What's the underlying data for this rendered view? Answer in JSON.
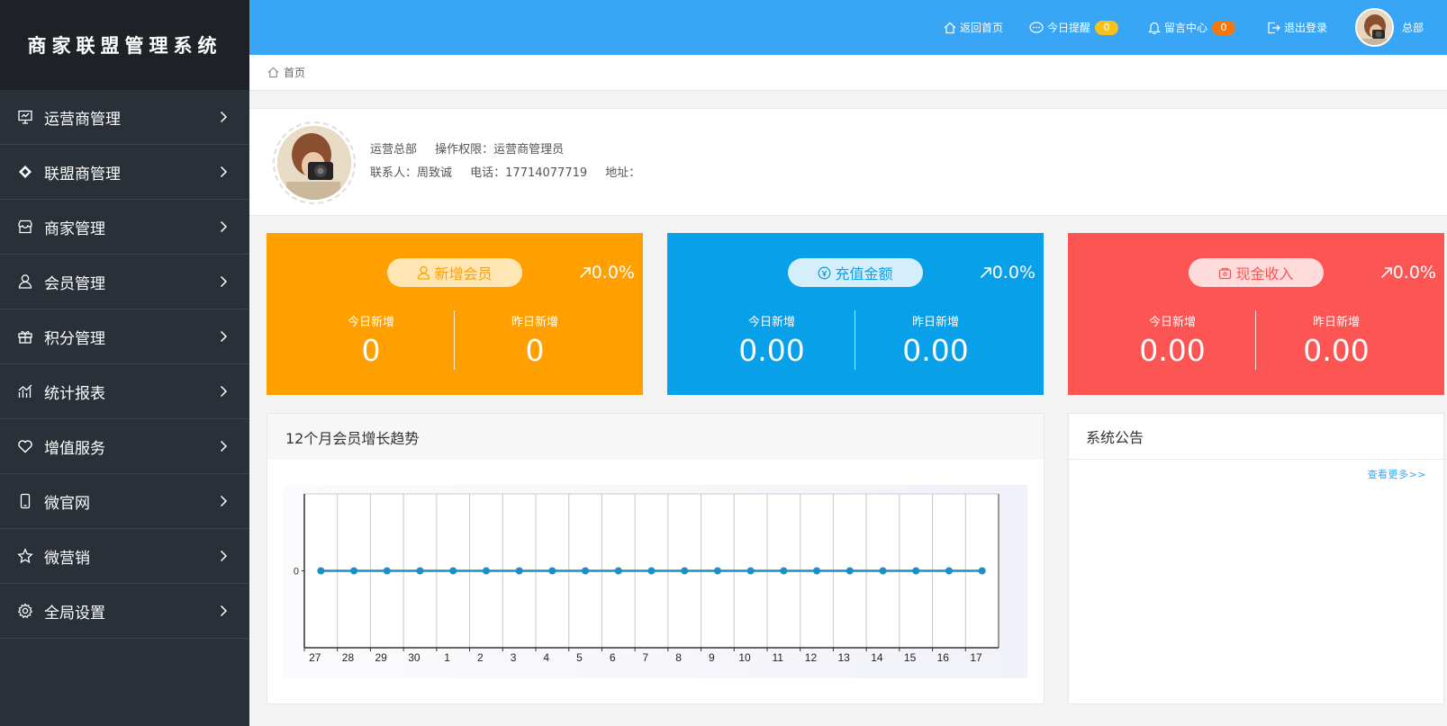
{
  "brand": "商家联盟管理系统",
  "sidebar": {
    "items": [
      {
        "label": "运营商管理",
        "icon": "presentation-icon"
      },
      {
        "label": "联盟商管理",
        "icon": "diamond-icon"
      },
      {
        "label": "商家管理",
        "icon": "store-icon"
      },
      {
        "label": "会员管理",
        "icon": "user-icon"
      },
      {
        "label": "积分管理",
        "icon": "gift-icon"
      },
      {
        "label": "统计报表",
        "icon": "chart-icon"
      },
      {
        "label": "增值服务",
        "icon": "heart-icon"
      },
      {
        "label": "微官网",
        "icon": "mobile-icon"
      },
      {
        "label": "微营销",
        "icon": "star-icon"
      },
      {
        "label": "全局设置",
        "icon": "gear-icon"
      }
    ]
  },
  "topbar": {
    "home": "返回首页",
    "reminder": "今日提醒",
    "reminder_count": "0",
    "messages": "留言中心",
    "messages_count": "0",
    "logout": "退出登录",
    "user": "总部"
  },
  "breadcrumb": {
    "home": "首页"
  },
  "profile": {
    "org": "运营总部",
    "permission": "操作权限：运营商管理员",
    "contact": "联系人：周致诚",
    "phone": "电话：17714077719",
    "address": "地址："
  },
  "cards": [
    {
      "title": "新增会员",
      "trend": "0.0%",
      "today_label": "今日新增",
      "today_value": "0",
      "yesterday_label": "昨日新增",
      "yesterday_value": "0",
      "color": "#ff9f00"
    },
    {
      "title": "充值金额",
      "trend": "0.0%",
      "today_label": "今日新增",
      "today_value": "0.00",
      "yesterday_label": "昨日新增",
      "yesterday_value": "0.00",
      "color": "#08a0e9"
    },
    {
      "title": "现金收入",
      "trend": "0.0%",
      "today_label": "今日新增",
      "today_value": "0.00",
      "yesterday_label": "昨日新增",
      "yesterday_value": "0.00",
      "color": "#fd5554"
    }
  ],
  "chart_panel": {
    "title": "12个月会员增长趋势"
  },
  "chart_data": {
    "type": "line",
    "title": "",
    "xlabel": "",
    "ylabel": "",
    "categories": [
      "27",
      "28",
      "29",
      "30",
      "1",
      "2",
      "3",
      "4",
      "5",
      "6",
      "7",
      "8",
      "9",
      "10",
      "11",
      "12",
      "13",
      "14",
      "15",
      "16",
      "17"
    ],
    "values": [
      0,
      0,
      0,
      0,
      0,
      0,
      0,
      0,
      0,
      0,
      0,
      0,
      0,
      0,
      0,
      0,
      0,
      0,
      0,
      0,
      0
    ],
    "y_ticks": [
      "0"
    ],
    "line_color": "#1a8fc9",
    "grid": true
  },
  "notice_panel": {
    "title": "系统公告",
    "more": "查看更多>>"
  }
}
